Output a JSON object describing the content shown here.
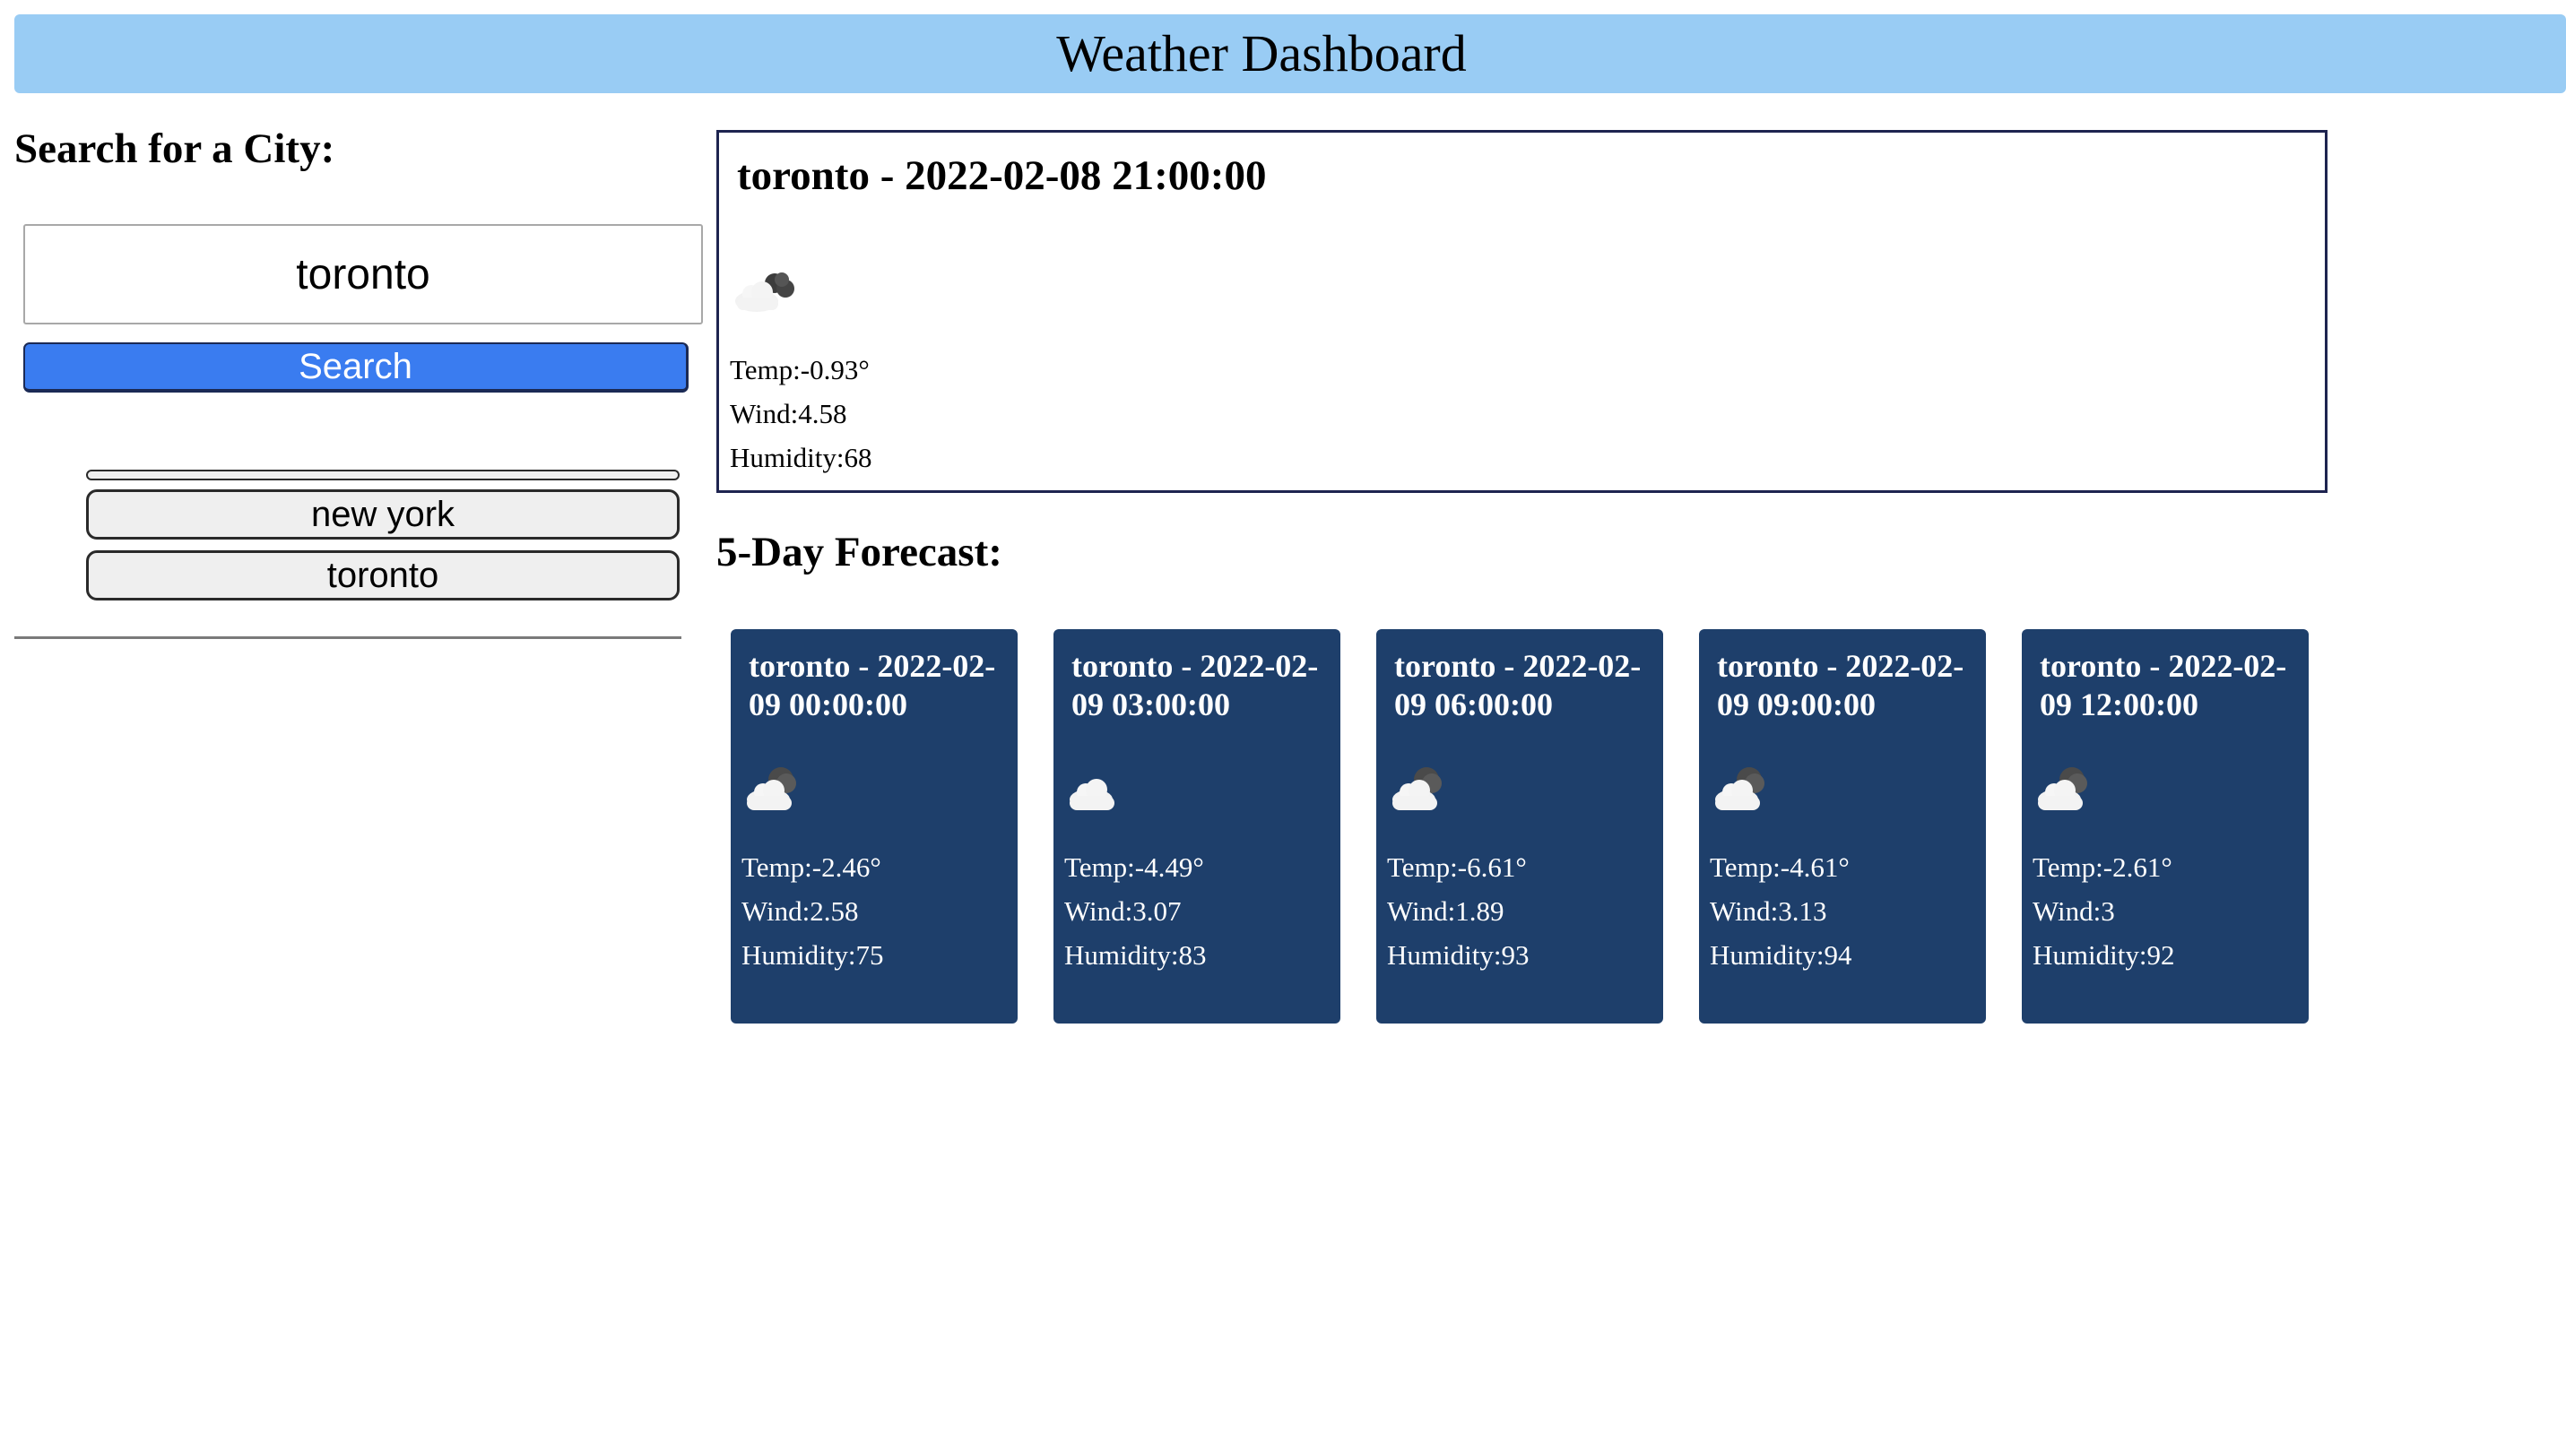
{
  "header": {
    "title": "Weather Dashboard"
  },
  "sidebar": {
    "heading": "Search for a City:",
    "search_value": "toronto",
    "search_button_label": "Search",
    "history": [
      "new york",
      "toronto"
    ]
  },
  "current": {
    "title": "toronto - 2022-02-08 21:00:00",
    "icon": "cloudy-night-icon",
    "temp": "Temp:-0.93°",
    "wind": "Wind:4.58",
    "humidity": "Humidity:68"
  },
  "forecast": {
    "heading": "5-Day Forecast:",
    "days": [
      {
        "title": "toronto - 2022-02-09 00:00:00",
        "icon": "partly-cloudy-night-icon",
        "temp": "Temp:-2.46°",
        "wind": "Wind:2.58",
        "humidity": "Humidity:75"
      },
      {
        "title": "toronto - 2022-02-09 03:00:00",
        "icon": "cloud-icon",
        "temp": "Temp:-4.49°",
        "wind": "Wind:3.07",
        "humidity": "Humidity:83"
      },
      {
        "title": "toronto - 2022-02-09 06:00:00",
        "icon": "partly-cloudy-night-icon",
        "temp": "Temp:-6.61°",
        "wind": "Wind:1.89",
        "humidity": "Humidity:93"
      },
      {
        "title": "toronto - 2022-02-09 09:00:00",
        "icon": "partly-cloudy-night-icon",
        "temp": "Temp:-4.61°",
        "wind": "Wind:3.13",
        "humidity": "Humidity:94"
      },
      {
        "title": "toronto - 2022-02-09 12:00:00",
        "icon": "partly-cloudy-night-icon",
        "temp": "Temp:-2.61°",
        "wind": "Wind:3",
        "humidity": "Humidity:92"
      }
    ]
  },
  "colors": {
    "header_bg": "#99ccf4",
    "search_button_bg": "#3a7cf0",
    "card_bg": "#1e3f6b",
    "current_border": "#1e2450"
  }
}
